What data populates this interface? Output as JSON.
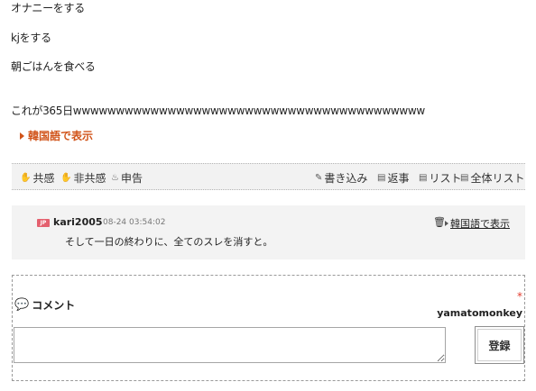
{
  "post": {
    "lines": [
      "オナニーをする",
      "kjをする",
      "朝ごはんを食べる",
      "これが365日wwwwwwwwwwwwwwwwwwwwwwwwwwwwwwwwwwwwwwwww"
    ],
    "translate_label": "韓国語で表示"
  },
  "actions": {
    "empathy": "共感",
    "non_empathy": "非共感",
    "report": "申告",
    "write": "書き込み",
    "reply": "返事",
    "list": "リスト",
    "all_list": "全体リスト"
  },
  "reply": {
    "badge": "JP",
    "user": "kari2005",
    "time": "08-24 03:54:02",
    "text": "そして一日の終わりに、全てのスレを消すと。",
    "translate_label": "韓国語で表示"
  },
  "comment": {
    "title": "コメント",
    "required_mark": "*",
    "user": "yamatomonkey",
    "input_value": "",
    "submit_label": "登録"
  },
  "colors": {
    "accent": "#d1541a",
    "badge": "#e4606e",
    "required": "#e23b2e"
  }
}
